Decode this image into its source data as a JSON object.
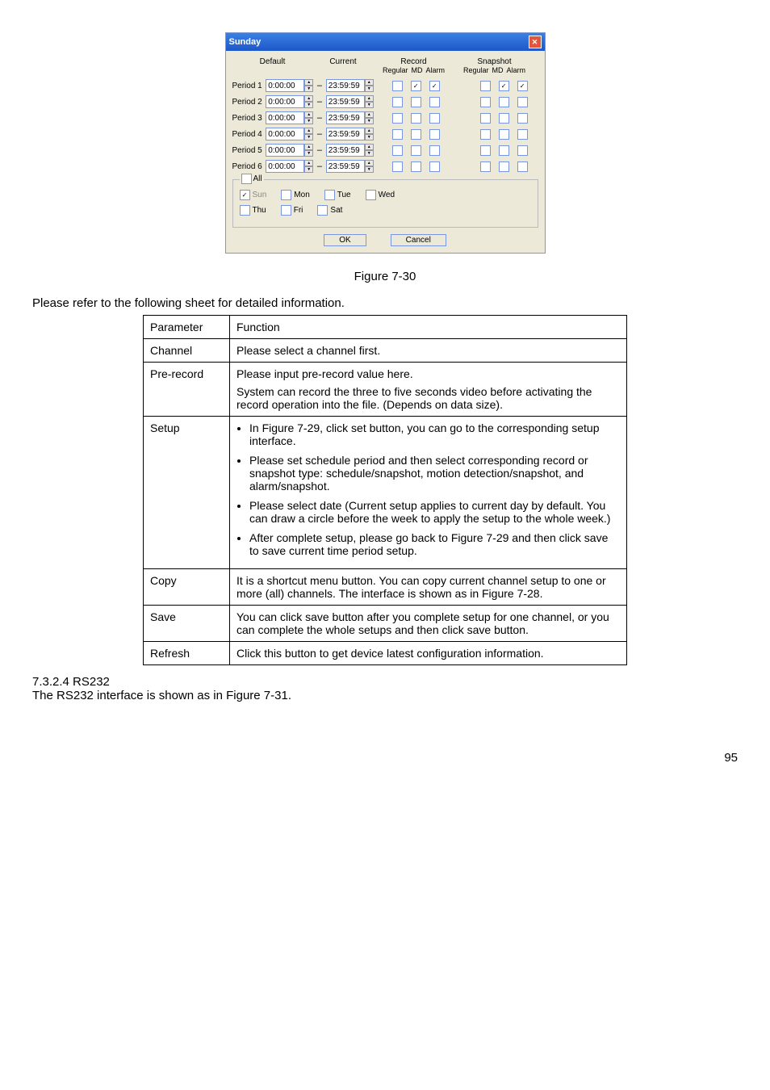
{
  "dialog": {
    "title": "Sunday",
    "headers": {
      "default": "Default",
      "current": "Current",
      "record": "Record",
      "snapshot": "Snapshot",
      "regular": "Regular",
      "md": "MD",
      "alarm": "Alarm"
    },
    "periods": [
      {
        "label": "Period 1",
        "start": "0:00:00",
        "end": "23:59:59",
        "rec": [
          false,
          true,
          true
        ],
        "snap": [
          false,
          true,
          true
        ]
      },
      {
        "label": "Period 2",
        "start": "0:00:00",
        "end": "23:59:59",
        "rec": [
          false,
          false,
          false
        ],
        "snap": [
          false,
          false,
          false
        ]
      },
      {
        "label": "Period 3",
        "start": "0:00:00",
        "end": "23:59:59",
        "rec": [
          false,
          false,
          false
        ],
        "snap": [
          false,
          false,
          false
        ]
      },
      {
        "label": "Period 4",
        "start": "0:00:00",
        "end": "23:59:59",
        "rec": [
          false,
          false,
          false
        ],
        "snap": [
          false,
          false,
          false
        ]
      },
      {
        "label": "Period 5",
        "start": "0:00:00",
        "end": "23:59:59",
        "rec": [
          false,
          false,
          false
        ],
        "snap": [
          false,
          false,
          false
        ]
      },
      {
        "label": "Period 6",
        "start": "0:00:00",
        "end": "23:59:59",
        "rec": [
          false,
          false,
          false
        ],
        "snap": [
          false,
          false,
          false
        ]
      }
    ],
    "all": "All",
    "days": {
      "sun": "Sun",
      "mon": "Mon",
      "tue": "Tue",
      "wed": "Wed",
      "thu": "Thu",
      "fri": "Fri",
      "sat": "Sat"
    },
    "ok": "OK",
    "cancel": "Cancel"
  },
  "figcaption": "Figure 7-30",
  "intro": "Please refer to the following sheet for detailed information.",
  "table": {
    "head": {
      "param": "Parameter",
      "func": "Function"
    },
    "rows": {
      "channel": {
        "p": "Channel",
        "f": "Please select a channel first."
      },
      "prerecord": {
        "p": "Pre-record",
        "f1": "Please input pre-record value here.",
        "f2": "System can record the three to five seconds video before activating the record operation into the file. (Depends on data size)."
      },
      "setup": {
        "p": "Setup",
        "b1": "In Figure 7-29, click set button, you can go to the corresponding setup interface.",
        "b2": "Please set schedule period and then select corresponding record or snapshot type: schedule/snapshot, motion detection/snapshot, and alarm/snapshot.",
        "b3": "Please select date (Current setup applies to current day by default. You can draw a circle before the week to apply the setup to the whole week.)",
        "b4": "After complete setup, please go back to Figure 7-29 and then click save to save current time period setup."
      },
      "copy": {
        "p": "Copy",
        "f": "It is a shortcut menu button. You can copy current channel setup to one or more (all) channels.  The interface is shown as in Figure 7-28."
      },
      "save": {
        "p": "Save",
        "f": "You can click save button after you complete setup for one channel, or you can complete the whole setups and then click save button."
      },
      "refresh": {
        "p": "Refresh",
        "f": "Click this button to get device latest configuration information."
      }
    }
  },
  "section": {
    "num": "7.3.2.4  RS232",
    "body": "The RS232 interface is shown as in Figure 7-31."
  },
  "pagenum": "95"
}
